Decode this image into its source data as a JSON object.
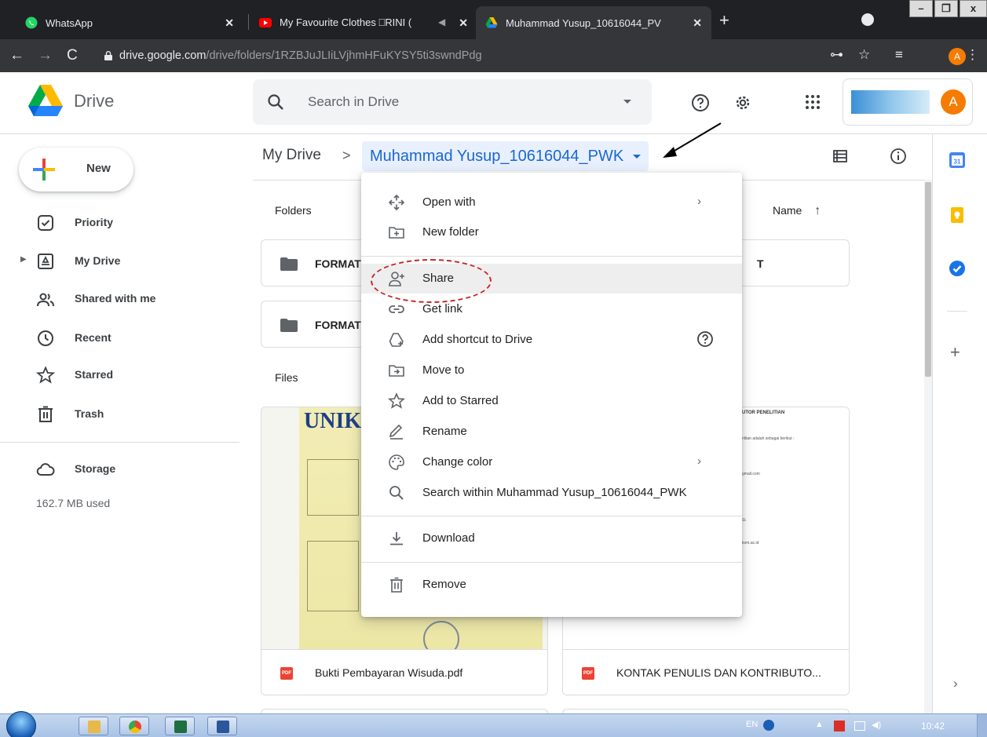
{
  "browser": {
    "tabs": [
      {
        "title": "WhatsApp"
      },
      {
        "title": "My Favourite Clothes ⎕RINI ("
      },
      {
        "title": "Muhammad Yusup_10616044_PV"
      }
    ],
    "url_host": "drive.google.com",
    "url_path": "/drive/folders/1RZBJuJLIiLVjhmHFuKYSY5ti3swndPdg",
    "profile_initial": "A"
  },
  "header": {
    "app_name": "Drive",
    "search_placeholder": "Search in Drive",
    "account_initial": "A"
  },
  "sidebar": {
    "new_label": "New",
    "items": [
      {
        "label": "Priority",
        "icon": "priority-icon"
      },
      {
        "label": "My Drive",
        "icon": "my-drive-icon"
      },
      {
        "label": "Shared with me",
        "icon": "shared-icon"
      },
      {
        "label": "Recent",
        "icon": "clock-icon"
      },
      {
        "label": "Starred",
        "icon": "star-icon"
      },
      {
        "label": "Trash",
        "icon": "trash-icon"
      }
    ],
    "storage_label": "Storage",
    "storage_used": "162.7 MB used"
  },
  "breadcrumb": {
    "root": "My Drive",
    "separator": ">",
    "current": "Muhammad Yusup_10616044_PWK"
  },
  "main": {
    "folders_heading": "Folders",
    "files_heading": "Files",
    "sort_label": "Name",
    "folders": [
      {
        "name": "FORMAT"
      },
      {
        "name": "T"
      },
      {
        "name": "FORMAT"
      }
    ],
    "files": [
      {
        "name": "Bukti Pembayaran Wisuda.pdf",
        "type": "PDF"
      },
      {
        "name": "KONTAK PENULIS DAN KONTRIBUTO...",
        "type": "PDF"
      }
    ],
    "thumb_text": {
      "unik": "UNIK",
      "tor": "UTOR PENELITIAN",
      "line1": "rilitan adalah sebagai berikut :",
      "line2": "gmail.com",
      "line3": "Si.",
      "line4": "kom.ac.id"
    }
  },
  "context_menu": {
    "items": [
      {
        "label": "Open with",
        "icon": "open-with-icon",
        "submenu": true
      },
      {
        "label": "New folder",
        "icon": "new-folder-icon"
      },
      {
        "label": "Share",
        "icon": "share-icon",
        "highlighted": true
      },
      {
        "label": "Get link",
        "icon": "link-icon"
      },
      {
        "label": "Add shortcut to Drive",
        "icon": "shortcut-icon",
        "help": true
      },
      {
        "label": "Move to",
        "icon": "move-icon"
      },
      {
        "label": "Add to Starred",
        "icon": "star-icon"
      },
      {
        "label": "Rename",
        "icon": "rename-icon"
      },
      {
        "label": "Change color",
        "icon": "palette-icon",
        "submenu": true
      },
      {
        "label": "Search within Muhammad Yusup_10616044_PWK",
        "icon": "search-icon"
      },
      {
        "label": "Download",
        "icon": "download-icon"
      },
      {
        "label": "Remove",
        "icon": "trash-icon"
      }
    ]
  },
  "taskbar": {
    "language": "EN",
    "clock": "10:42"
  },
  "colors": {
    "accent": "#1967d2",
    "highlight_bg": "#e8f0fe",
    "annotation": "#c62828"
  }
}
